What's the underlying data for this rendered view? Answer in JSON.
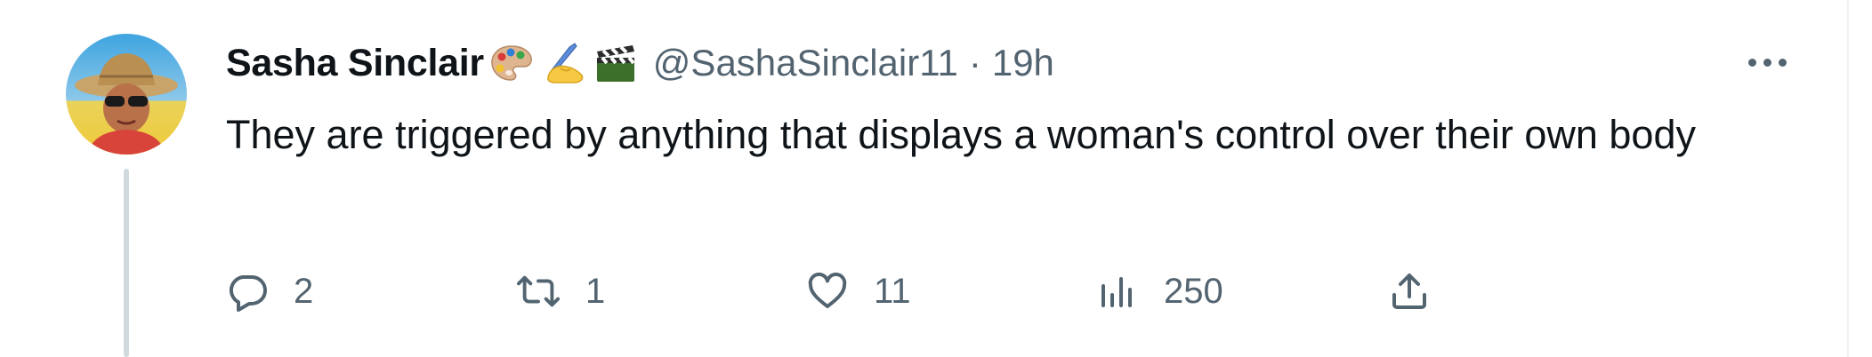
{
  "tweet": {
    "author_name": "Sasha Sinclair",
    "author_emojis": [
      "artist-palette",
      "writing-hand",
      "clapper-board"
    ],
    "handle": "@SashaSinclair11",
    "separator": "·",
    "time": "19h",
    "text": "They are triggered by anything that displays a woman's control over their own body"
  },
  "actions": {
    "reply": {
      "icon": "reply-icon",
      "count": "2"
    },
    "retweet": {
      "icon": "retweet-icon",
      "count": "1"
    },
    "like": {
      "icon": "heart-icon",
      "count": "11"
    },
    "views": {
      "icon": "analytics-icon",
      "count": "250"
    },
    "share": {
      "icon": "share-icon"
    }
  },
  "colors": {
    "text": "#0f1419",
    "muted": "#536471",
    "thread_line": "#cfd9de"
  }
}
